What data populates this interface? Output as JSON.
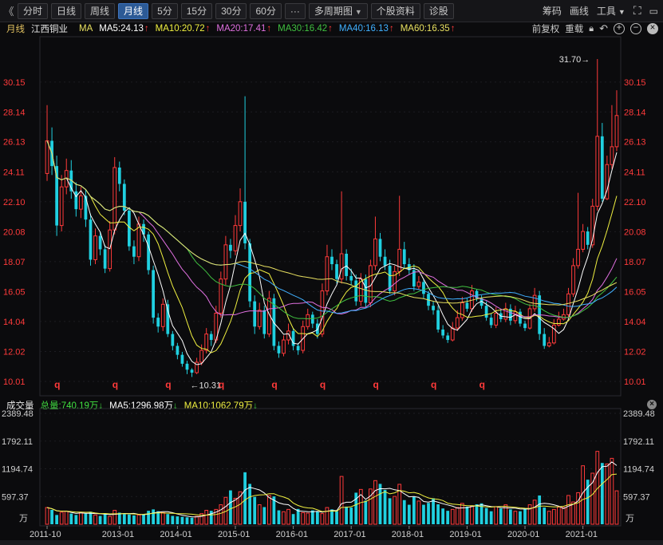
{
  "toolbar": {
    "back": "《",
    "tabs": [
      "分时",
      "日线",
      "周线",
      "月线",
      "5分",
      "15分",
      "30分",
      "60分",
      "···",
      "多周期图",
      "个股资料",
      "诊股"
    ],
    "active_tab": "月线",
    "dropdown_tab": "多周期图",
    "right": {
      "chips": "筹码",
      "draw": "画线",
      "tools": "工具"
    }
  },
  "legend": {
    "period": "月线",
    "name": "江西铜业",
    "ma_label": "MA",
    "items": [
      {
        "label": "MA5:24.13",
        "arrow": "↑",
        "color": "#ffffff"
      },
      {
        "label": "MA10:20.72",
        "arrow": "↑",
        "color": "#f0f040"
      },
      {
        "label": "MA20:17.41",
        "arrow": "↑",
        "color": "#e070e0"
      },
      {
        "label": "MA30:16.42",
        "arrow": "↑",
        "color": "#40c040"
      },
      {
        "label": "MA40:16.13",
        "arrow": "↑",
        "color": "#40b0ff"
      },
      {
        "label": "MA60:16.35",
        "arrow": "↑",
        "color": "#e8e060"
      }
    ],
    "right": {
      "adjust": "前复权",
      "overlay": "重载"
    }
  },
  "volume_legend": {
    "label": "成交量",
    "total": "总量:740.19万",
    "total_arrow": "↓",
    "ma5": "MA5:1296.98万",
    "ma5_arrow": "↓",
    "ma10": "MA10:1062.79万",
    "ma10_arrow": "↓"
  },
  "colors": {
    "up": "#ff3a3a",
    "down": "#20d0e0",
    "background": "#0b0b0d"
  },
  "chart_data": {
    "type": "candlestick",
    "title": "江西铜业 月线",
    "price_ticks": [
      "30.15",
      "28.14",
      "26.13",
      "24.11",
      "22.10",
      "20.08",
      "18.07",
      "16.05",
      "14.04",
      "12.02",
      "10.01"
    ],
    "price_range": [
      10.01,
      31.7
    ],
    "max_label": "31.70",
    "max_arrow": "→",
    "min_label": "10.31",
    "min_arrow": "←",
    "q_marker": "q",
    "q_months": [
      2,
      14,
      25,
      36,
      47,
      57,
      68,
      80,
      90
    ],
    "volume_ticks": [
      "2389.48",
      "1792.11",
      "1194.74",
      "597.37"
    ],
    "volume_unit": "万",
    "volume_range": [
      0,
      2389.48
    ],
    "x_labels": [
      {
        "label": "2011-10",
        "i": 0
      },
      {
        "label": "2013-01",
        "i": 15
      },
      {
        "label": "2014-01",
        "i": 27
      },
      {
        "label": "2015-01",
        "i": 39
      },
      {
        "label": "2016-01",
        "i": 51
      },
      {
        "label": "2017-01",
        "i": 63
      },
      {
        "label": "2018-01",
        "i": 75
      },
      {
        "label": "2019-01",
        "i": 87
      },
      {
        "label": "2020-01",
        "i": 99
      },
      {
        "label": "2021-01",
        "i": 111
      }
    ],
    "close": [
      26.2,
      24.5,
      20.5,
      23.1,
      24.2,
      22.8,
      21.6,
      22.5,
      20.9,
      18.2,
      19.8,
      18.9,
      17.6,
      20.2,
      24.4,
      23.3,
      21.5,
      19.1,
      18.4,
      20.6,
      19.9,
      17.5,
      14.3,
      13.7,
      15.2,
      13.2,
      12.4,
      11.8,
      11.2,
      10.8,
      10.6,
      11.3,
      12.1,
      13.2,
      12.8,
      14.6,
      16.9,
      19.2,
      18.8,
      20.5,
      22.1,
      19.3,
      15.4,
      13.7,
      14.8,
      13.2,
      15.6,
      12.4,
      11.9,
      12.8,
      13.4,
      12.4,
      12.1,
      13.7,
      14.5,
      13.9,
      13.2,
      16.1,
      18.4,
      17.9,
      16.9,
      18.6,
      17.1,
      16.8,
      15.4,
      16.9,
      15.3,
      17.8,
      19.6,
      18.4,
      17.8,
      16.1,
      17.4,
      18.9,
      17.9,
      17.5,
      16.4,
      16.7,
      15.9,
      15.1,
      14.8,
      13.5,
      13.1,
      12.8,
      13.6,
      14.3,
      15.3,
      14.9,
      16.1,
      15.6,
      15.1,
      14.3,
      13.8,
      14.6,
      14.2,
      14.9,
      14.1,
      14.7,
      13.9,
      13.6,
      14.9,
      15.8,
      13.2,
      12.4,
      12.6,
      13.8,
      14.2,
      14.5,
      15.9,
      17.8,
      18.9,
      20.1,
      19.2,
      21.8,
      26.5,
      22.3,
      24.6,
      25.8,
      27.9
    ],
    "open": [
      24.0,
      26.2,
      24.5,
      20.5,
      23.1,
      24.2,
      22.8,
      21.6,
      22.5,
      20.9,
      18.2,
      19.8,
      18.9,
      17.6,
      20.2,
      24.4,
      23.3,
      21.5,
      19.1,
      18.4,
      20.6,
      19.9,
      17.5,
      14.3,
      13.7,
      15.2,
      13.2,
      12.4,
      11.8,
      11.2,
      10.8,
      10.6,
      11.3,
      12.1,
      13.2,
      12.8,
      14.6,
      16.9,
      19.2,
      18.8,
      20.5,
      22.1,
      19.3,
      15.4,
      13.7,
      14.8,
      13.2,
      15.6,
      12.4,
      11.9,
      12.8,
      13.4,
      12.4,
      12.1,
      13.7,
      14.5,
      13.9,
      13.2,
      16.1,
      18.4,
      17.9,
      16.9,
      18.6,
      17.1,
      16.8,
      15.4,
      16.9,
      15.3,
      17.8,
      19.6,
      18.4,
      17.8,
      16.1,
      17.4,
      18.9,
      17.9,
      17.5,
      16.4,
      16.7,
      15.9,
      15.1,
      14.8,
      13.5,
      13.1,
      12.8,
      13.6,
      14.3,
      15.3,
      14.9,
      16.1,
      15.6,
      15.1,
      14.3,
      13.8,
      14.6,
      14.2,
      14.9,
      14.1,
      14.7,
      13.9,
      13.6,
      14.9,
      15.8,
      13.2,
      12.4,
      12.6,
      13.8,
      14.2,
      14.5,
      15.9,
      17.8,
      18.9,
      20.1,
      19.2,
      21.8,
      26.5,
      22.3,
      24.6,
      25.8
    ],
    "high": [
      28.6,
      27.1,
      25.2,
      23.9,
      25.0,
      24.9,
      23.4,
      23.1,
      22.9,
      21.3,
      20.3,
      20.1,
      19.2,
      20.8,
      25.1,
      24.8,
      23.6,
      21.7,
      19.5,
      21.1,
      20.9,
      20.1,
      17.8,
      14.6,
      15.6,
      15.5,
      13.4,
      12.6,
      12.0,
      11.4,
      10.9,
      11.6,
      12.5,
      13.6,
      13.4,
      15.1,
      17.4,
      19.8,
      19.6,
      21.2,
      23.0,
      29.2,
      19.6,
      15.8,
      15.3,
      15.1,
      16.1,
      15.9,
      12.7,
      13.1,
      13.9,
      13.6,
      12.6,
      14.1,
      14.9,
      14.7,
      14.2,
      16.6,
      19.2,
      18.9,
      18.2,
      22.8,
      18.9,
      17.6,
      17.2,
      17.3,
      17.2,
      18.2,
      21.1,
      20.0,
      18.9,
      18.2,
      17.8,
      22.5,
      19.4,
      18.3,
      17.9,
      17.1,
      16.9,
      16.1,
      15.4,
      15.1,
      13.8,
      13.3,
      14.0,
      14.8,
      15.7,
      15.6,
      16.5,
      16.2,
      15.8,
      15.4,
      14.6,
      15.0,
      14.9,
      15.3,
      15.2,
      15.1,
      14.9,
      14.1,
      15.2,
      16.3,
      16.1,
      13.6,
      13.0,
      14.2,
      14.7,
      14.9,
      16.3,
      18.3,
      22.7,
      20.6,
      20.4,
      22.3,
      31.7,
      27.4,
      25.2,
      28.6,
      29.6
    ],
    "low": [
      23.5,
      23.9,
      19.8,
      20.1,
      22.6,
      22.3,
      21.1,
      21.0,
      20.4,
      17.8,
      17.9,
      18.5,
      17.3,
      17.4,
      19.9,
      22.8,
      21.2,
      18.8,
      17.9,
      18.1,
      19.4,
      17.2,
      13.9,
      13.3,
      13.4,
      13.0,
      12.1,
      11.5,
      11.0,
      10.5,
      10.31,
      10.5,
      11.1,
      11.9,
      12.4,
      12.6,
      14.3,
      16.5,
      18.3,
      18.5,
      20.1,
      18.9,
      15.0,
      13.2,
      13.5,
      12.9,
      13.0,
      12.1,
      11.6,
      11.7,
      12.5,
      12.1,
      11.8,
      11.9,
      13.5,
      13.6,
      12.9,
      13.0,
      15.8,
      17.5,
      16.6,
      16.6,
      16.8,
      16.5,
      15.1,
      15.1,
      15.0,
      15.0,
      17.5,
      18.1,
      17.5,
      15.9,
      15.8,
      17.1,
      17.6,
      17.2,
      16.1,
      16.2,
      15.6,
      14.8,
      14.5,
      13.3,
      12.9,
      12.6,
      12.7,
      13.4,
      14.1,
      14.7,
      14.7,
      15.4,
      14.9,
      14.1,
      13.6,
      13.6,
      14.0,
      14.0,
      13.8,
      13.9,
      13.7,
      13.4,
      13.5,
      14.7,
      12.8,
      12.2,
      12.3,
      12.5,
      13.7,
      14.1,
      14.3,
      15.7,
      17.6,
      18.7,
      18.9,
      19.0,
      21.5,
      22.1,
      22.2,
      24.3,
      25.5
    ],
    "volume": [
      360,
      310,
      200,
      260,
      280,
      230,
      200,
      250,
      230,
      270,
      200,
      180,
      220,
      170,
      300,
      250,
      220,
      210,
      190,
      200,
      210,
      290,
      320,
      280,
      250,
      220,
      180,
      170,
      160,
      150,
      140,
      170,
      230,
      300,
      290,
      320,
      420,
      580,
      730,
      560,
      700,
      1120,
      870,
      590,
      420,
      370,
      620,
      600,
      300,
      270,
      320,
      220,
      330,
      250,
      240,
      300,
      280,
      230,
      360,
      320,
      280,
      1030,
      380,
      360,
      680,
      750,
      510,
      760,
      940,
      870,
      740,
      560,
      600,
      860,
      520,
      420,
      590,
      500,
      420,
      460,
      560,
      430,
      340,
      290,
      320,
      360,
      450,
      380,
      390,
      430,
      450,
      350,
      280,
      380,
      340,
      420,
      320,
      280,
      280,
      340,
      420,
      520,
      620,
      360,
      280,
      320,
      370,
      360,
      620,
      480,
      680,
      1260,
      960,
      1100,
      1570,
      1320,
      1300,
      1420,
      720
    ]
  }
}
